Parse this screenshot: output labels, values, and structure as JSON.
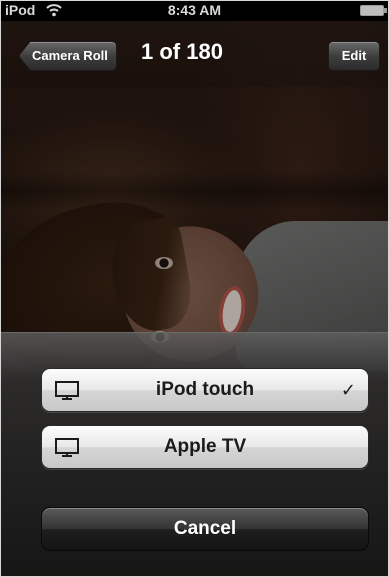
{
  "status_bar": {
    "carrier": "iPod",
    "wifi_icon": "wifi-icon",
    "time": "8:43 AM",
    "battery_icon": "battery-icon"
  },
  "nav_bar": {
    "back_label": "Camera Roll",
    "title": "1 of 180",
    "edit_label": "Edit"
  },
  "action_sheet": {
    "options": [
      {
        "label": "iPod touch",
        "icon": "monitor-icon",
        "selected": true,
        "check": "✓"
      },
      {
        "label": "Apple TV",
        "icon": "monitor-icon",
        "selected": false
      }
    ],
    "cancel_label": "Cancel"
  },
  "colors": {
    "light_button": "#e8e8e8",
    "dark_button": "#2b2b2b",
    "text_light": "#ffffff",
    "text_dark": "#1b1b1b"
  }
}
